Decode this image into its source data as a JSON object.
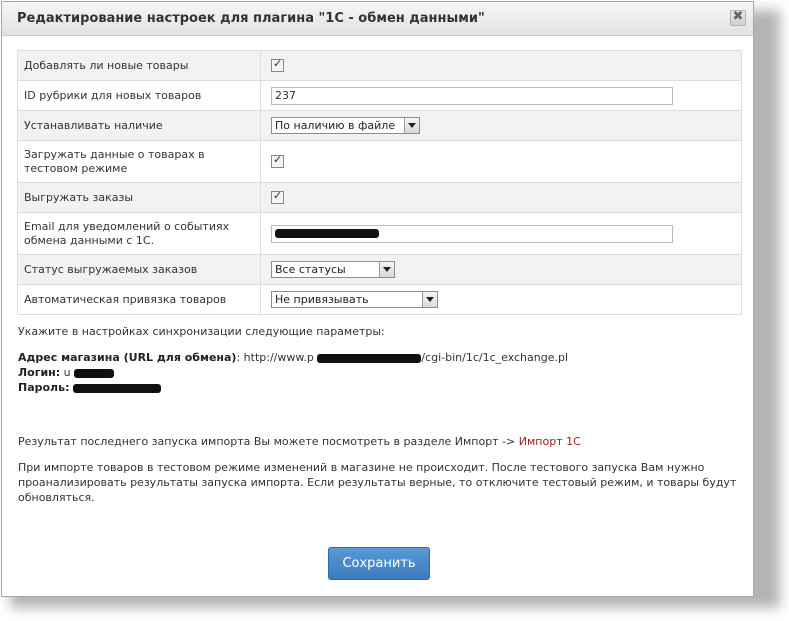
{
  "dialog": {
    "title": "Редактирование настроек для плагина \"1С - обмен данными\"",
    "close_label": "✖"
  },
  "settings": [
    {
      "label": "Добавлять ли новые товары",
      "type": "checkbox",
      "checked": true
    },
    {
      "label": "ID рубрики для новых товаров",
      "type": "text",
      "value": "237"
    },
    {
      "label": "Устанавливать наличие",
      "type": "select",
      "value": "По наличию в файле"
    },
    {
      "label": "Загружать данные о товарах в тестовом режиме",
      "type": "checkbox",
      "checked": true
    },
    {
      "label": "Выгружать заказы",
      "type": "checkbox",
      "checked": true
    },
    {
      "label": "Email для уведомлений о событиях обмена данными с 1С.",
      "type": "text",
      "value": "[redacted]"
    },
    {
      "label": "Статус выгружаемых заказов",
      "type": "select",
      "value": "Все статусы"
    },
    {
      "label": "Автоматическая привязка товаров",
      "type": "select",
      "value": "Не привязывать"
    }
  ],
  "checkmark": "✓",
  "sync": {
    "intro": "Укажите в настройках синхронизации следующие параметры:",
    "address_label": "Адрес магазина (URL для обмена)",
    "address_prefix": ": http://www.p",
    "address_suffix": "/cgi-bin/1c/1c_exchange.pl",
    "login_label": "Логин:",
    "login_prefix": " u",
    "password_label": "Пароль:",
    "password_prefix": " "
  },
  "import_info": {
    "text": "Результат последнего запуска импорта Вы можете посмотреть в разделе Импорт -> ",
    "link": "Импорт 1С"
  },
  "test_note": "При импорте товаров в тестовом режиме изменений в магазине не происходит. После тестового запуска Вам нужно проанализировать результаты запуска импорта. Если результаты верные, то отключите тестовый режим, и товары будут обновляться.",
  "buttons": {
    "save": "Сохранить"
  }
}
